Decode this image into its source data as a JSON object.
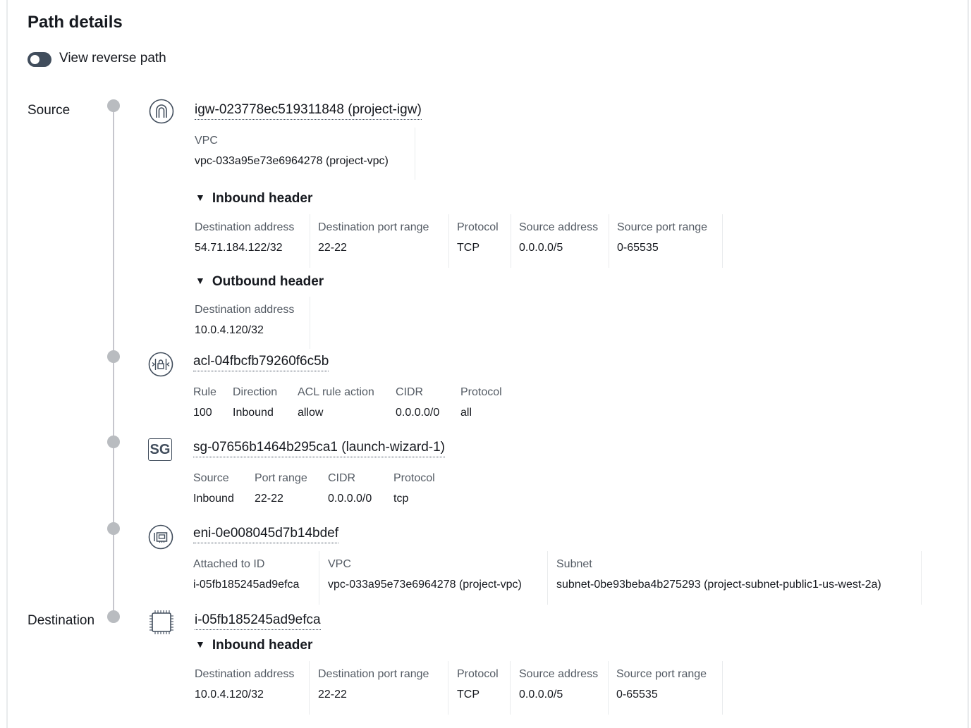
{
  "page": {
    "title": "Path details"
  },
  "toggle": {
    "label": "View reverse path",
    "on": false
  },
  "labels": {
    "source": "Source",
    "destination": "Destination"
  },
  "hops": {
    "igw": {
      "icon": "internet-gateway-icon",
      "name": "igw-023778ec519311848 (project-igw)",
      "vpc_label": "VPC",
      "vpc_value": "vpc-033a95e73e6964278 (project-vpc)",
      "inbound": {
        "title": "Inbound header",
        "fields": [
          {
            "label": "Destination address",
            "value": "54.71.184.122/32"
          },
          {
            "label": "Destination port range",
            "value": "22-22"
          },
          {
            "label": "Protocol",
            "value": "TCP"
          },
          {
            "label": "Source address",
            "value": "0.0.0.0/5"
          },
          {
            "label": "Source port range",
            "value": "0-65535"
          }
        ]
      },
      "outbound": {
        "title": "Outbound header",
        "fields": [
          {
            "label": "Destination address",
            "value": "10.0.4.120/32"
          }
        ]
      }
    },
    "acl": {
      "icon": "network-acl-icon",
      "name": "acl-04fbcfb79260f6c5b",
      "fields": [
        {
          "label": "Rule",
          "value": "100"
        },
        {
          "label": "Direction",
          "value": "Inbound"
        },
        {
          "label": "ACL rule action",
          "value": "allow"
        },
        {
          "label": "CIDR",
          "value": "0.0.0.0/0"
        },
        {
          "label": "Protocol",
          "value": "all"
        }
      ]
    },
    "sg": {
      "icon": "security-group-icon",
      "icon_text": "SG",
      "name": "sg-07656b1464b295ca1 (launch-wizard-1)",
      "fields": [
        {
          "label": "Source",
          "value": "Inbound"
        },
        {
          "label": "Port range",
          "value": "22-22"
        },
        {
          "label": "CIDR",
          "value": "0.0.0.0/0"
        },
        {
          "label": "Protocol",
          "value": "tcp"
        }
      ]
    },
    "eni": {
      "icon": "network-interface-icon",
      "name": "eni-0e008045d7b14bdef",
      "fields": [
        {
          "label": "Attached to ID",
          "value": "i-05fb185245ad9efca"
        },
        {
          "label": "VPC",
          "value": "vpc-033a95e73e6964278 (project-vpc)"
        },
        {
          "label": "Subnet",
          "value": "subnet-0be93beba4b275293 (project-subnet-public1-us-west-2a)"
        }
      ]
    },
    "instance": {
      "icon": "instance-chip-icon",
      "name": "i-05fb185245ad9efca",
      "inbound": {
        "title": "Inbound header",
        "fields": [
          {
            "label": "Destination address",
            "value": "10.0.4.120/32"
          },
          {
            "label": "Destination port range",
            "value": "22-22"
          },
          {
            "label": "Protocol",
            "value": "TCP"
          },
          {
            "label": "Source address",
            "value": "0.0.0.0/5"
          },
          {
            "label": "Source port range",
            "value": "0-65535"
          }
        ]
      }
    }
  }
}
